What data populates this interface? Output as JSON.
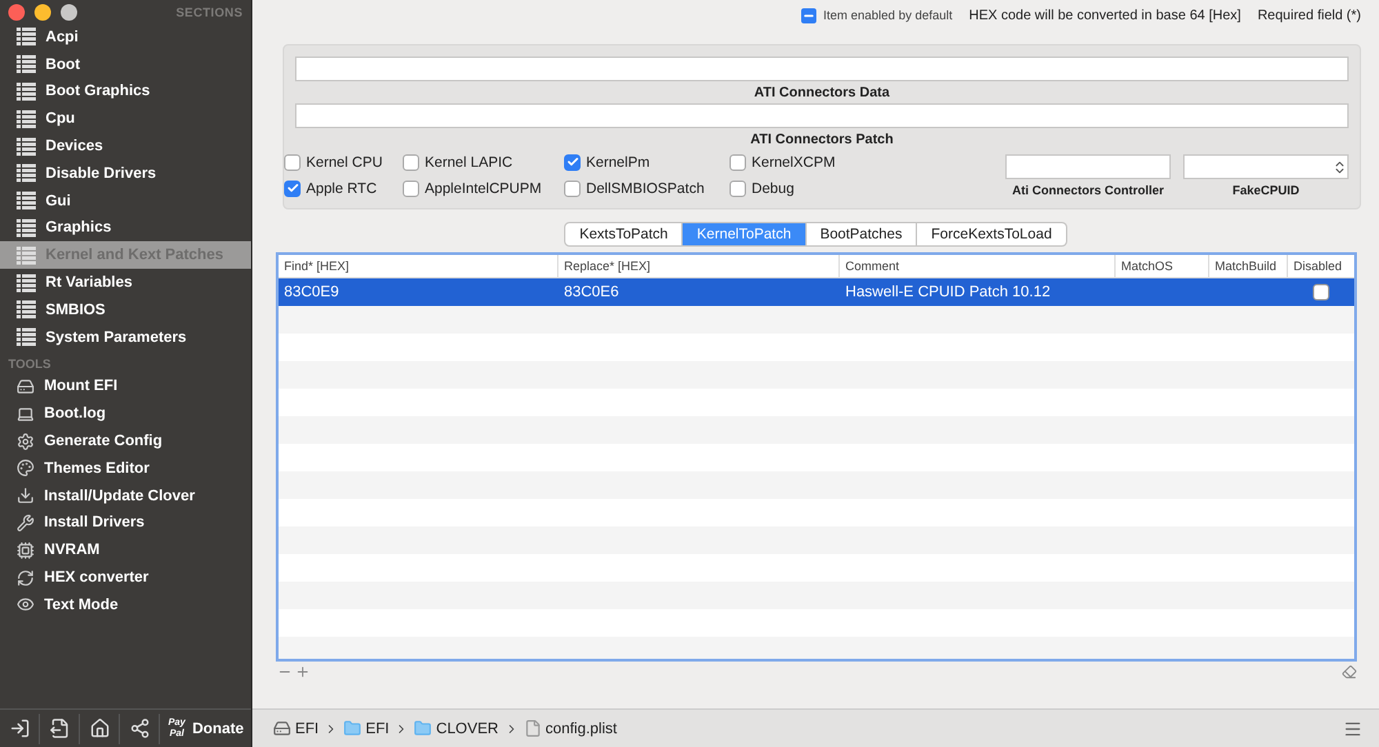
{
  "window": {
    "controls": [
      {
        "kind": "close"
      },
      {
        "kind": "minimize"
      },
      {
        "kind": "zoom"
      }
    ]
  },
  "sidebar": {
    "sections_title": "SECTIONS",
    "sections": [
      {
        "label": "Acpi",
        "selected": false
      },
      {
        "label": "Boot",
        "selected": false
      },
      {
        "label": "Boot Graphics",
        "selected": false
      },
      {
        "label": "Cpu",
        "selected": false
      },
      {
        "label": "Devices",
        "selected": false
      },
      {
        "label": "Disable Drivers",
        "selected": false
      },
      {
        "label": "Gui",
        "selected": false
      },
      {
        "label": "Graphics",
        "selected": false
      },
      {
        "label": "Kernel and Kext Patches",
        "selected": true
      },
      {
        "label": "Rt Variables",
        "selected": false
      },
      {
        "label": "SMBIOS",
        "selected": false
      },
      {
        "label": "System Parameters",
        "selected": false
      }
    ],
    "tools_title": "TOOLS",
    "tools": [
      {
        "label": "Mount EFI"
      },
      {
        "label": "Boot.log"
      },
      {
        "label": "Generate Config"
      },
      {
        "label": "Themes Editor"
      },
      {
        "label": "Install/Update Clover"
      },
      {
        "label": "Install Drivers"
      },
      {
        "label": "NVRAM"
      },
      {
        "label": "HEX converter"
      },
      {
        "label": "Text Mode"
      }
    ],
    "bottom_bar": {
      "paypal_top": "Pay",
      "paypal_bottom": "Pal",
      "donate": "Donate"
    }
  },
  "legend": {
    "enabled_default": "Item enabled by default",
    "hex_note": "HEX code will be converted in base 64 [Hex]",
    "required_note": "Required field (*)"
  },
  "ati_fields": [
    {
      "label": "ATI Connectors Data"
    },
    {
      "label": "ATI Connectors Patch"
    }
  ],
  "options": [
    {
      "label": "Kernel CPU",
      "checked": false
    },
    {
      "label": "Kernel LAPIC",
      "checked": false
    },
    {
      "label": "KernelPm",
      "checked": true
    },
    {
      "label": "KernelXCPM",
      "checked": false
    },
    {
      "label": "Apple RTC",
      "checked": true
    },
    {
      "label": "AppleIntelCPUPM",
      "checked": false
    },
    {
      "label": "DellSMBIOSPatch",
      "checked": false
    },
    {
      "label": "Debug",
      "checked": false
    }
  ],
  "small_fields": [
    {
      "label": "Ati Connectors Controller",
      "kind": "text"
    },
    {
      "label": "FakeCPUID",
      "kind": "stepper"
    }
  ],
  "tabs": [
    {
      "label": "KextsToPatch",
      "selected": false
    },
    {
      "label": "KernelToPatch",
      "selected": true
    },
    {
      "label": "BootPatches",
      "selected": false
    },
    {
      "label": "ForceKextsToLoad",
      "selected": false
    }
  ],
  "table": {
    "columns": [
      "Find* [HEX]",
      "Replace* [HEX]",
      "Comment",
      "MatchOS",
      "MatchBuild",
      "Disabled"
    ],
    "rows": [
      {
        "find": "83C0E9",
        "replace": "83C0E6",
        "comment": "Haswell-E CPUID Patch 10.12",
        "disabled": false,
        "selected": true
      }
    ]
  },
  "path_bar": [
    "EFI",
    "EFI",
    "CLOVER",
    "config.plist"
  ]
}
